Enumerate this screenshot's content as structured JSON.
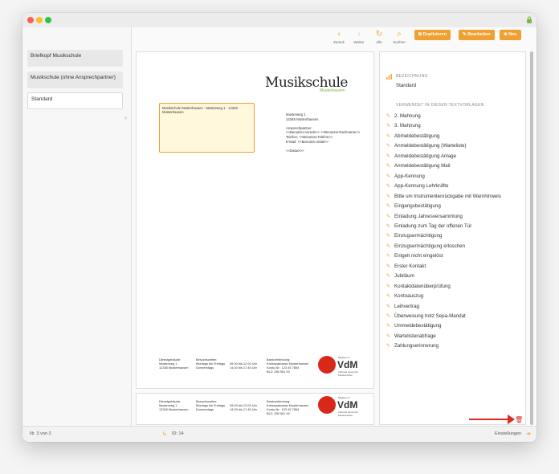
{
  "window": {
    "colors": {
      "close": "#fe5f57",
      "minimize": "#febc2e",
      "zoom": "#28c840",
      "accent": "#f0a030",
      "lock": "#7ab648"
    }
  },
  "sidebar": {
    "items": [
      {
        "label": "Briefkopf Musikschule"
      },
      {
        "label": "Musikschule (ohne Ansprechpartner)"
      },
      {
        "label": "Standard"
      }
    ]
  },
  "toolbar": {
    "back": "Zurück",
    "forward": "Weiter",
    "all": "Alle",
    "search": "Suchen",
    "duplicate": "Duplizieren",
    "edit": "Bearbeiten",
    "new": "Neu"
  },
  "preview": {
    "logo_text": "Musikschule",
    "logo_sub": "Musterhausen",
    "address_line": "Musikschule Musterhausen · Musterweg 1 · 12345 Musterhausen",
    "sender_block": "Musterweg 1\n12345 Musterhausen\n\nAnsprechpartner\n<<Benutzer.Anrede>> <<Benutzer.Nachname>>\nTelefon: <<Benutzer.Telefon>>\nE-Mail: <<Benutzer.eMail>>\n\n<<Datum>>",
    "footer": {
      "col1": "Dienstgebäude:\nMusterweg 1\n12345 Musterhausen",
      "col2": "Besuchszeiten:\nMontags bis Freitags\nDonnerstags",
      "col3": "\n09.00 bis 12.00 Uhr\n14.00 bis 17.45 Uhr",
      "col4": "Bankverbindung:\nKreissparkasse Musterhausen\nKonto-Nr.: 123 45 7854\nBLZ: 280 501 00"
    },
    "vdm": {
      "top": "Mitglied im",
      "name": "VdM",
      "bottom": "Verband deutscher Musikschulen"
    }
  },
  "details": {
    "name_label": "BEZEICHNUNG",
    "name_value": "Standard",
    "used_label": "VERWENDET IN DIESEN TEXTVORLAGEN",
    "templates": [
      "2. Mahnung",
      "3. Mahnung",
      "Abmeldebestätigung",
      "Anmeldebestätigung (Warteliste)",
      "Anmeldebestätigung Anlage",
      "Anmeldebestätigung Mail",
      "App-Kennung",
      "App-Kennung Lehrkräfte",
      "Bitte um Instrumentenrückgabe mit Warnhinweis",
      "Eingangsbestätigung",
      "Einladung Jahresversammlung",
      "Einladung zum Tag der offenen Tür",
      "Einzugsermächtigung",
      "Einzugsermächtigung erloschen",
      "Entgelt nicht eingelöst",
      "Erster Kontakt",
      "Jubiläum",
      "Kontaktdatenüberprüfung",
      "Kontoauszug",
      "Leihvertrag",
      "Überweisung trotz Sepa-Mandat",
      "Ummeldebestätigung",
      "Wartelistenabfrage",
      "Zahlungserinnerung"
    ]
  },
  "status": {
    "record": "Nr. 3 von 3",
    "id": "ID: 14",
    "settings": "Einstellungen"
  }
}
